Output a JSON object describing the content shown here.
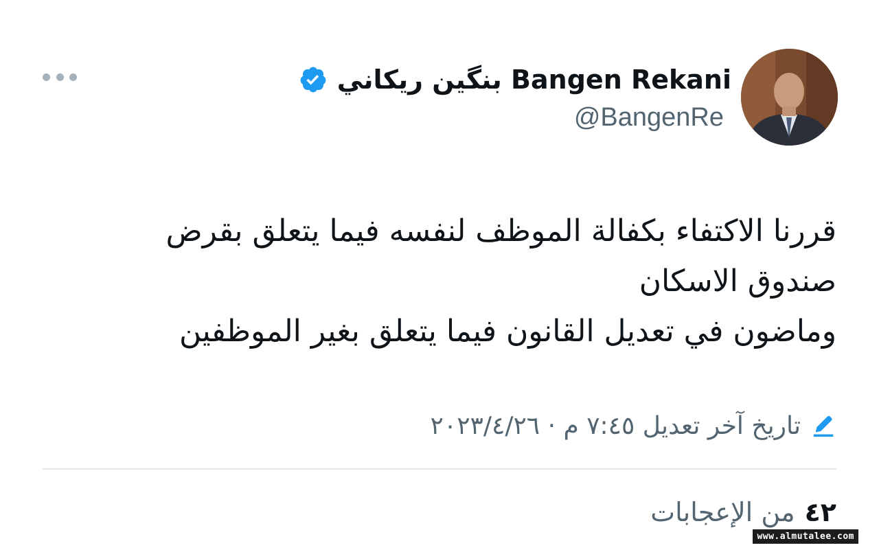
{
  "author": {
    "display_name": "بنگين ريكاني Bangen Rekani",
    "handle": "@BangenRe",
    "verified": true,
    "verified_color": "#1d9bf0"
  },
  "tweet": {
    "lines": [
      "قررنا الاكتفاء بكفالة الموظف لنفسه فيما يتعلق بقرض",
      "صندوق الاسكان",
      "وماضون في تعديل القانون فيما يتعلق بغير الموظفين"
    ]
  },
  "edited": {
    "label": "تاريخ آخر تعديل ٧:٤٥ م · ٢٠٢٣/٤/٢٦",
    "icon": "pencil-icon"
  },
  "likes": {
    "count": "٤٢",
    "label": "من الإعجابات"
  },
  "watermark": "www.almutalee.com",
  "icons": {
    "more": "more-icon",
    "verified": "verified-badge-icon",
    "edit": "pencil-icon"
  }
}
